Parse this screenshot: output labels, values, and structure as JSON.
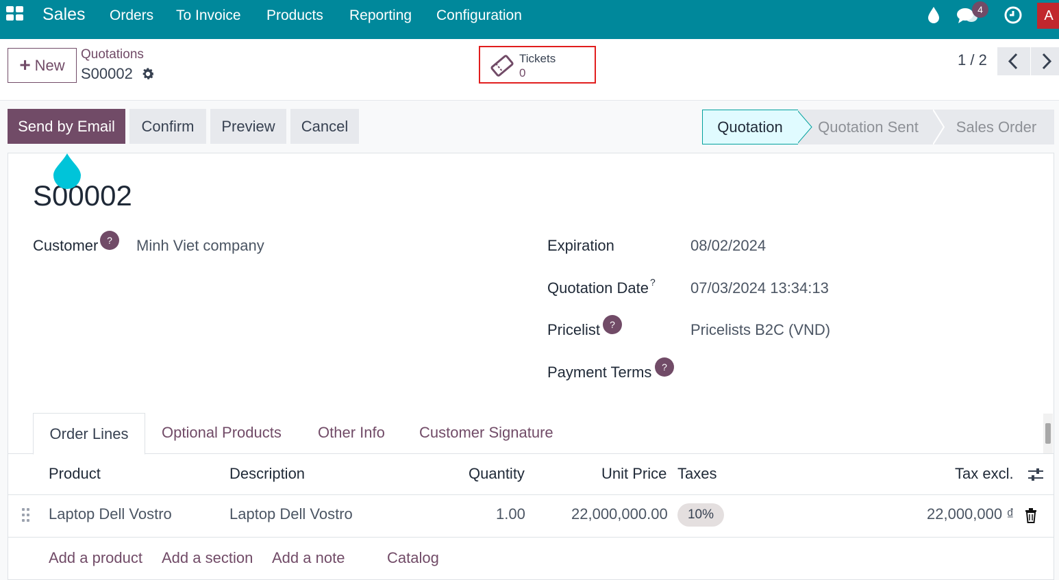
{
  "navbar": {
    "app_name": "Sales",
    "menu": [
      "Orders",
      "To Invoice",
      "Products",
      "Reporting",
      "Configuration"
    ],
    "notification_count": "4",
    "user_initial": "A",
    "icons": [
      "apps-grid-icon",
      "drop-icon",
      "chat-icon",
      "clock-icon"
    ]
  },
  "control_panel": {
    "new_label": "New",
    "breadcrumb_parent": "Quotations",
    "breadcrumb_current": "S00002",
    "smart_button": {
      "label": "Tickets",
      "value": "0"
    },
    "pager": "1 / 2"
  },
  "actions": {
    "send_by_email": "Send by Email",
    "confirm": "Confirm",
    "preview": "Preview",
    "cancel": "Cancel"
  },
  "statusbar": {
    "stages": [
      "Quotation",
      "Quotation Sent",
      "Sales Order"
    ],
    "active": "Quotation"
  },
  "form": {
    "title": "S00002",
    "customer": {
      "label": "Customer",
      "value": "Minh Viet company"
    },
    "expiration": {
      "label": "Expiration",
      "value": "08/02/2024"
    },
    "quotation_date": {
      "label": "Quotation Date",
      "value": "07/03/2024 13:34:13"
    },
    "pricelist": {
      "label": "Pricelist",
      "value": "Pricelists B2C (VND)"
    },
    "payment_terms": {
      "label": "Payment Terms",
      "value": ""
    },
    "help_glyph": "?"
  },
  "tabs": [
    "Order Lines",
    "Optional Products",
    "Other Info",
    "Customer Signature"
  ],
  "order_lines": {
    "columns": [
      "Product",
      "Description",
      "Quantity",
      "Unit Price",
      "Taxes",
      "Tax excl."
    ],
    "rows": [
      {
        "product": "Laptop Dell Vostro",
        "description": "Laptop Dell Vostro",
        "quantity": "1.00",
        "unit_price": "22,000,000.00",
        "taxes": "10%",
        "subtotal": "22,000,000 ₫"
      }
    ],
    "add_links": [
      "Add a product",
      "Add a section",
      "Add a note",
      "Catalog"
    ]
  },
  "colors": {
    "navbar": "#00889b",
    "primary": "#714b67",
    "highlight_border": "#e11d1d",
    "active_stage_bg": "#e0fbff"
  }
}
